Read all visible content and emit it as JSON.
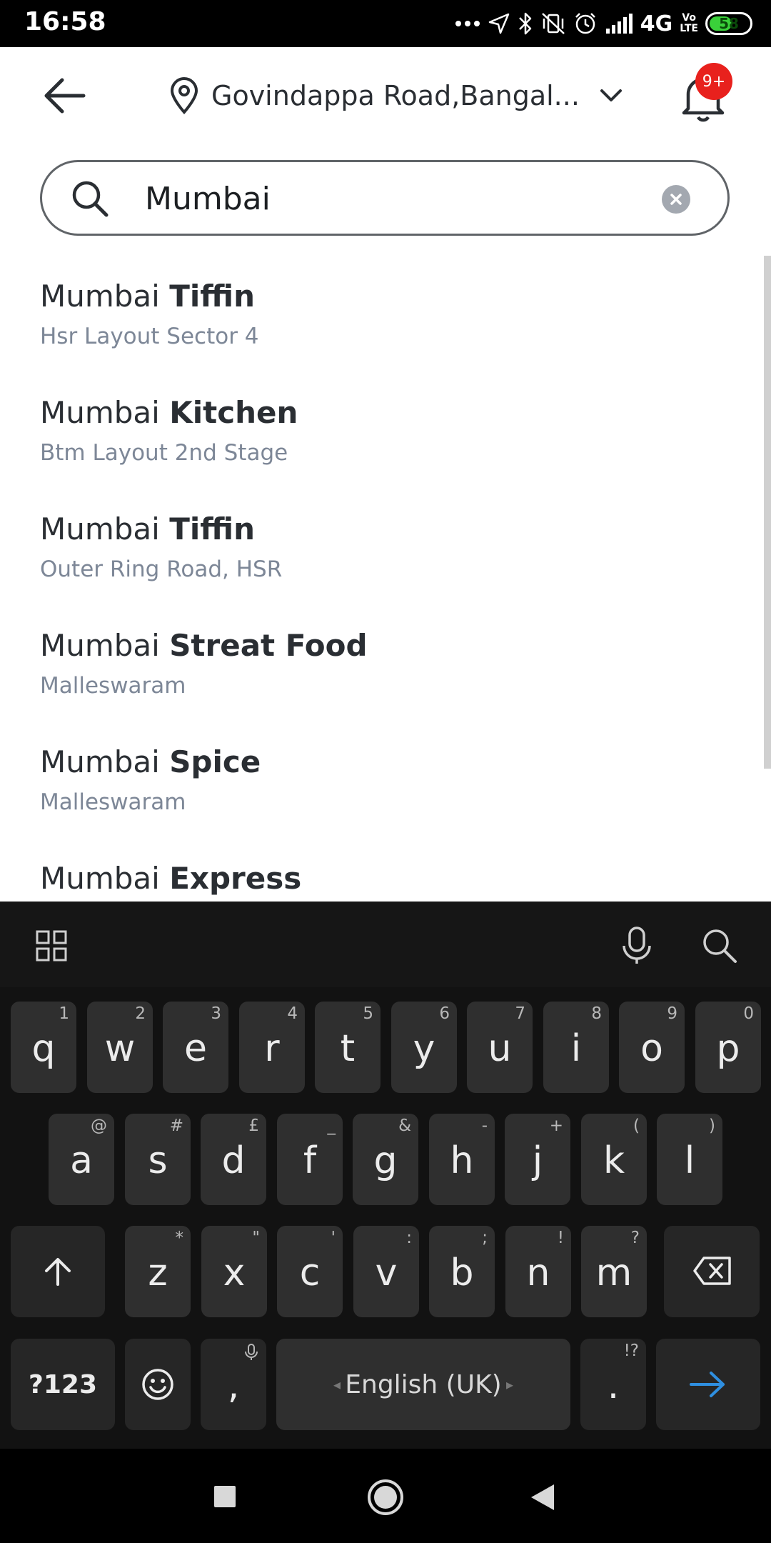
{
  "status_bar": {
    "time": "16:58",
    "network": "4G",
    "volte_top": "Vo",
    "volte_bottom": "LTE",
    "battery": "58",
    "battery_level": 0.58,
    "icons": [
      "more-dots-icon",
      "location-arrow-icon",
      "bluetooth-icon",
      "vibrate-off-icon",
      "alarm-icon",
      "signal-icon",
      "battery-icon"
    ]
  },
  "header": {
    "location": "Govindappa Road,Bangal...",
    "notification_badge": "9+",
    "badge_color": "#e8211d"
  },
  "search": {
    "value": "Mumbai"
  },
  "results": [
    {
      "prefix": "Mumbai ",
      "name": "Tiffin",
      "area": "Hsr Layout Sector 4"
    },
    {
      "prefix": "Mumbai ",
      "name": "Kitchen",
      "area": "Btm Layout 2nd Stage"
    },
    {
      "prefix": "Mumbai ",
      "name": "Tiffin",
      "area": "Outer Ring Road, HSR"
    },
    {
      "prefix": "Mumbai ",
      "name": "Streat Food",
      "area": "Malleswaram"
    },
    {
      "prefix": "Mumbai ",
      "name": "Spice",
      "area": "Malleswaram"
    },
    {
      "prefix": "Mumbai ",
      "name": "Express",
      "area": ""
    }
  ],
  "keyboard": {
    "row1": [
      {
        "k": "q",
        "h": "1"
      },
      {
        "k": "w",
        "h": "2"
      },
      {
        "k": "e",
        "h": "3"
      },
      {
        "k": "r",
        "h": "4"
      },
      {
        "k": "t",
        "h": "5"
      },
      {
        "k": "y",
        "h": "6"
      },
      {
        "k": "u",
        "h": "7"
      },
      {
        "k": "i",
        "h": "8"
      },
      {
        "k": "o",
        "h": "9"
      },
      {
        "k": "p",
        "h": "0"
      }
    ],
    "row2": [
      {
        "k": "a",
        "h": "@"
      },
      {
        "k": "s",
        "h": "#"
      },
      {
        "k": "d",
        "h": "£"
      },
      {
        "k": "f",
        "h": "_"
      },
      {
        "k": "g",
        "h": "&"
      },
      {
        "k": "h",
        "h": "-"
      },
      {
        "k": "j",
        "h": "+"
      },
      {
        "k": "k",
        "h": "("
      },
      {
        "k": "l",
        "h": ")"
      }
    ],
    "row3": [
      {
        "k": "z",
        "h": "*"
      },
      {
        "k": "x",
        "h": "\""
      },
      {
        "k": "c",
        "h": "'"
      },
      {
        "k": "v",
        "h": ":"
      },
      {
        "k": "b",
        "h": ";"
      },
      {
        "k": "n",
        "h": "!"
      },
      {
        "k": "m",
        "h": "?"
      }
    ],
    "symbols_label": "?123",
    "comma": ",",
    "space_label": "English (UK)",
    "period": ".",
    "period_hint": "!?",
    "enter_color": "#2f8fe0"
  },
  "navigation": {
    "icons": [
      "recents-icon",
      "home-icon",
      "back-icon"
    ]
  }
}
